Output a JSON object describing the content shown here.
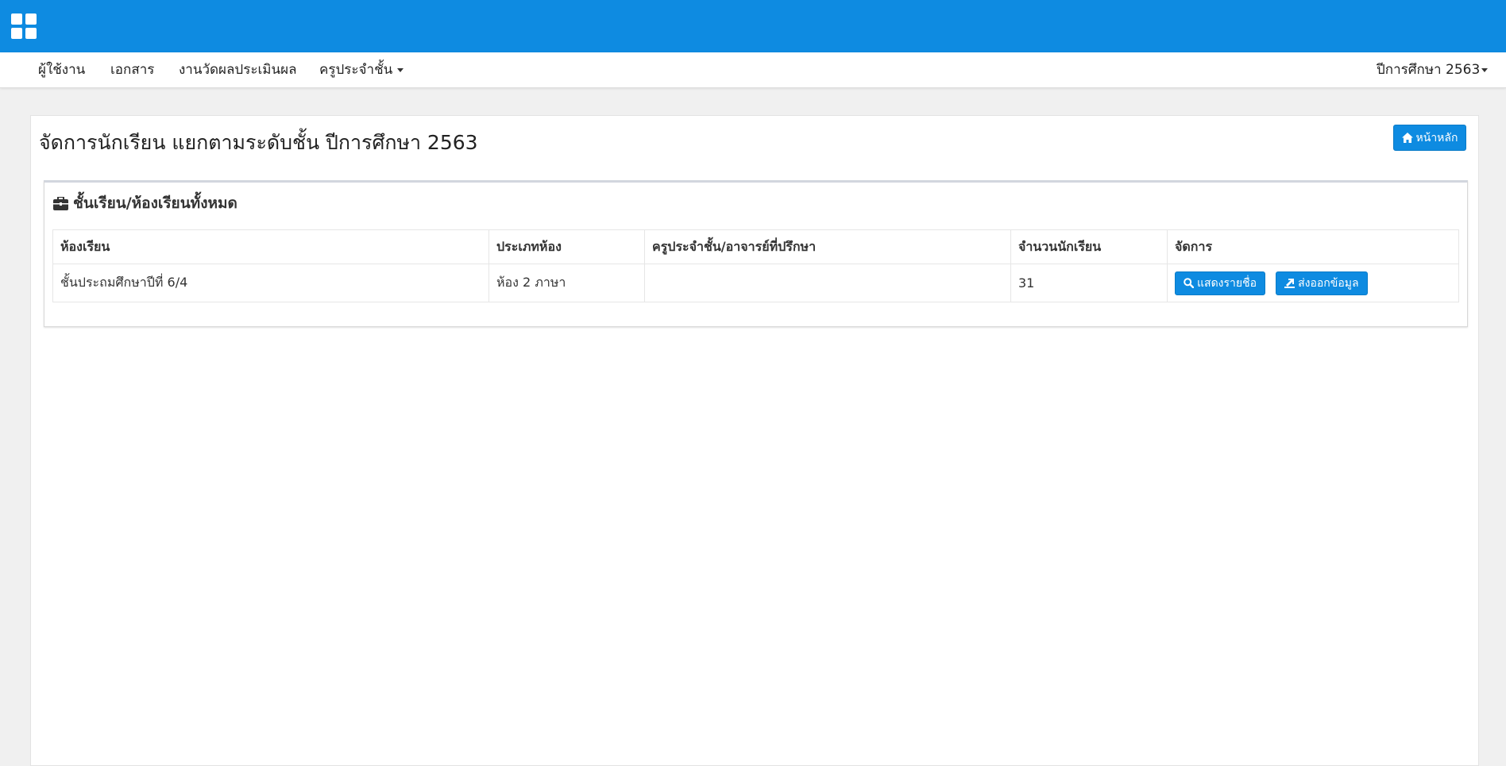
{
  "topbar": {
    "logo_icon": "grid-icon",
    "color": "#0e8be1"
  },
  "nav": {
    "items": [
      {
        "label": "ผู้ใช้งาน"
      },
      {
        "label": "เอกสาร"
      },
      {
        "label": "งานวัดผลประเมินผล"
      },
      {
        "label": "ครูประจำชั้น"
      }
    ],
    "year_menu": "ปีการศึกษา 2563"
  },
  "page": {
    "title": "จัดการนักเรียน แยกตามระดับชั้น ปีการศึกษา 2563",
    "home_button": "หน้าหลัก"
  },
  "box": {
    "title": "ชั้นเรียน/ห้องเรียนทั้งหมด",
    "icon": "briefcase-icon"
  },
  "table": {
    "headers": [
      "ห้องเรียน",
      "ประเภทห้อง",
      "ครูประจำชั้น/อาจารย์ที่ปรึกษา",
      "จำนวนนักเรียน",
      "จัดการ"
    ],
    "rows": [
      {
        "room": "ชั้นประถมศึกษาปีที่ 6/4",
        "type": "ห้อง 2 ภาษา",
        "teacher": "",
        "count": "31",
        "actions": {
          "show": "แสดงรายชื่อ",
          "export": "ส่งออกข้อมูล"
        }
      }
    ]
  },
  "colors": {
    "accent": "#0e8be1"
  }
}
